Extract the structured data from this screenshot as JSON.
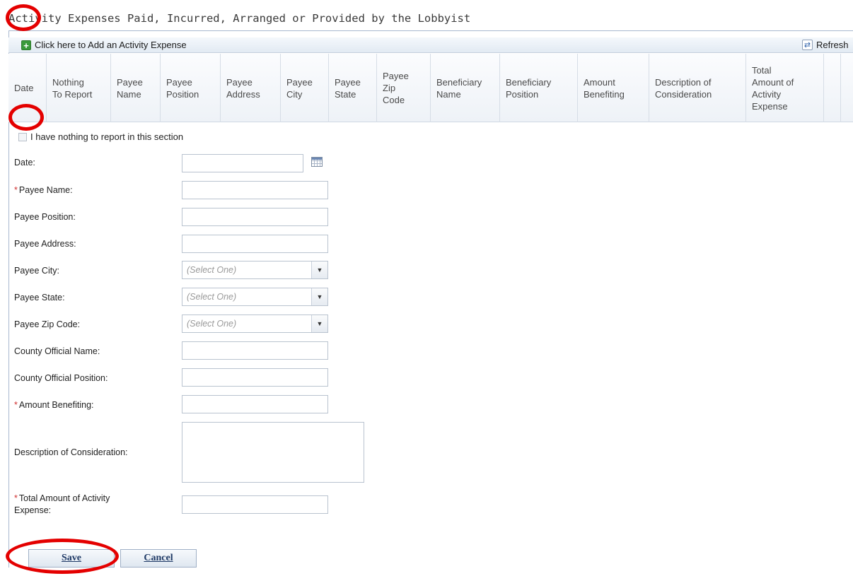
{
  "page": {
    "title": "Activity Expenses Paid, Incurred, Arranged or Provided by the Lobbyist"
  },
  "toolbar": {
    "add_label": "Click here to Add an Activity Expense",
    "refresh_label": "Refresh"
  },
  "columns": [
    [
      "Date"
    ],
    [
      "Nothing",
      "To Report"
    ],
    [
      "Payee",
      "Name"
    ],
    [
      "Payee",
      "Position"
    ],
    [
      "Payee",
      "Address"
    ],
    [
      "Payee",
      "City"
    ],
    [
      "Payee",
      "State"
    ],
    [
      "Payee",
      "Zip",
      "Code"
    ],
    [
      "Beneficiary",
      "Name"
    ],
    [
      "Beneficiary",
      "Position"
    ],
    [
      "Amount",
      "Benefiting"
    ],
    [
      "Description of",
      "Consideration"
    ],
    [
      "Total",
      "Amount of",
      "Activity",
      "Expense"
    ]
  ],
  "form": {
    "nothing_to_report": "I have nothing to report in this section",
    "date": "Date:",
    "payee_name": "Payee Name:",
    "payee_position": "Payee Position:",
    "payee_address": "Payee Address:",
    "payee_city": "Payee City:",
    "payee_state": "Payee State:",
    "payee_zip": "Payee Zip Code:",
    "county_official_name": "County Official Name:",
    "county_official_position": "County Official Position:",
    "amount_benefiting": "Amount Benefiting:",
    "description": "Description of Consideration:",
    "total_line1": "Total Amount of Activity",
    "total_line2": "Expense:",
    "required_mark": "*",
    "select_placeholder": "(Select One)"
  },
  "buttons": {
    "save": "Save",
    "cancel": "Cancel"
  },
  "colors": {
    "annotation": "#e40000",
    "required": "#d03030",
    "link": "#1f3a66"
  }
}
